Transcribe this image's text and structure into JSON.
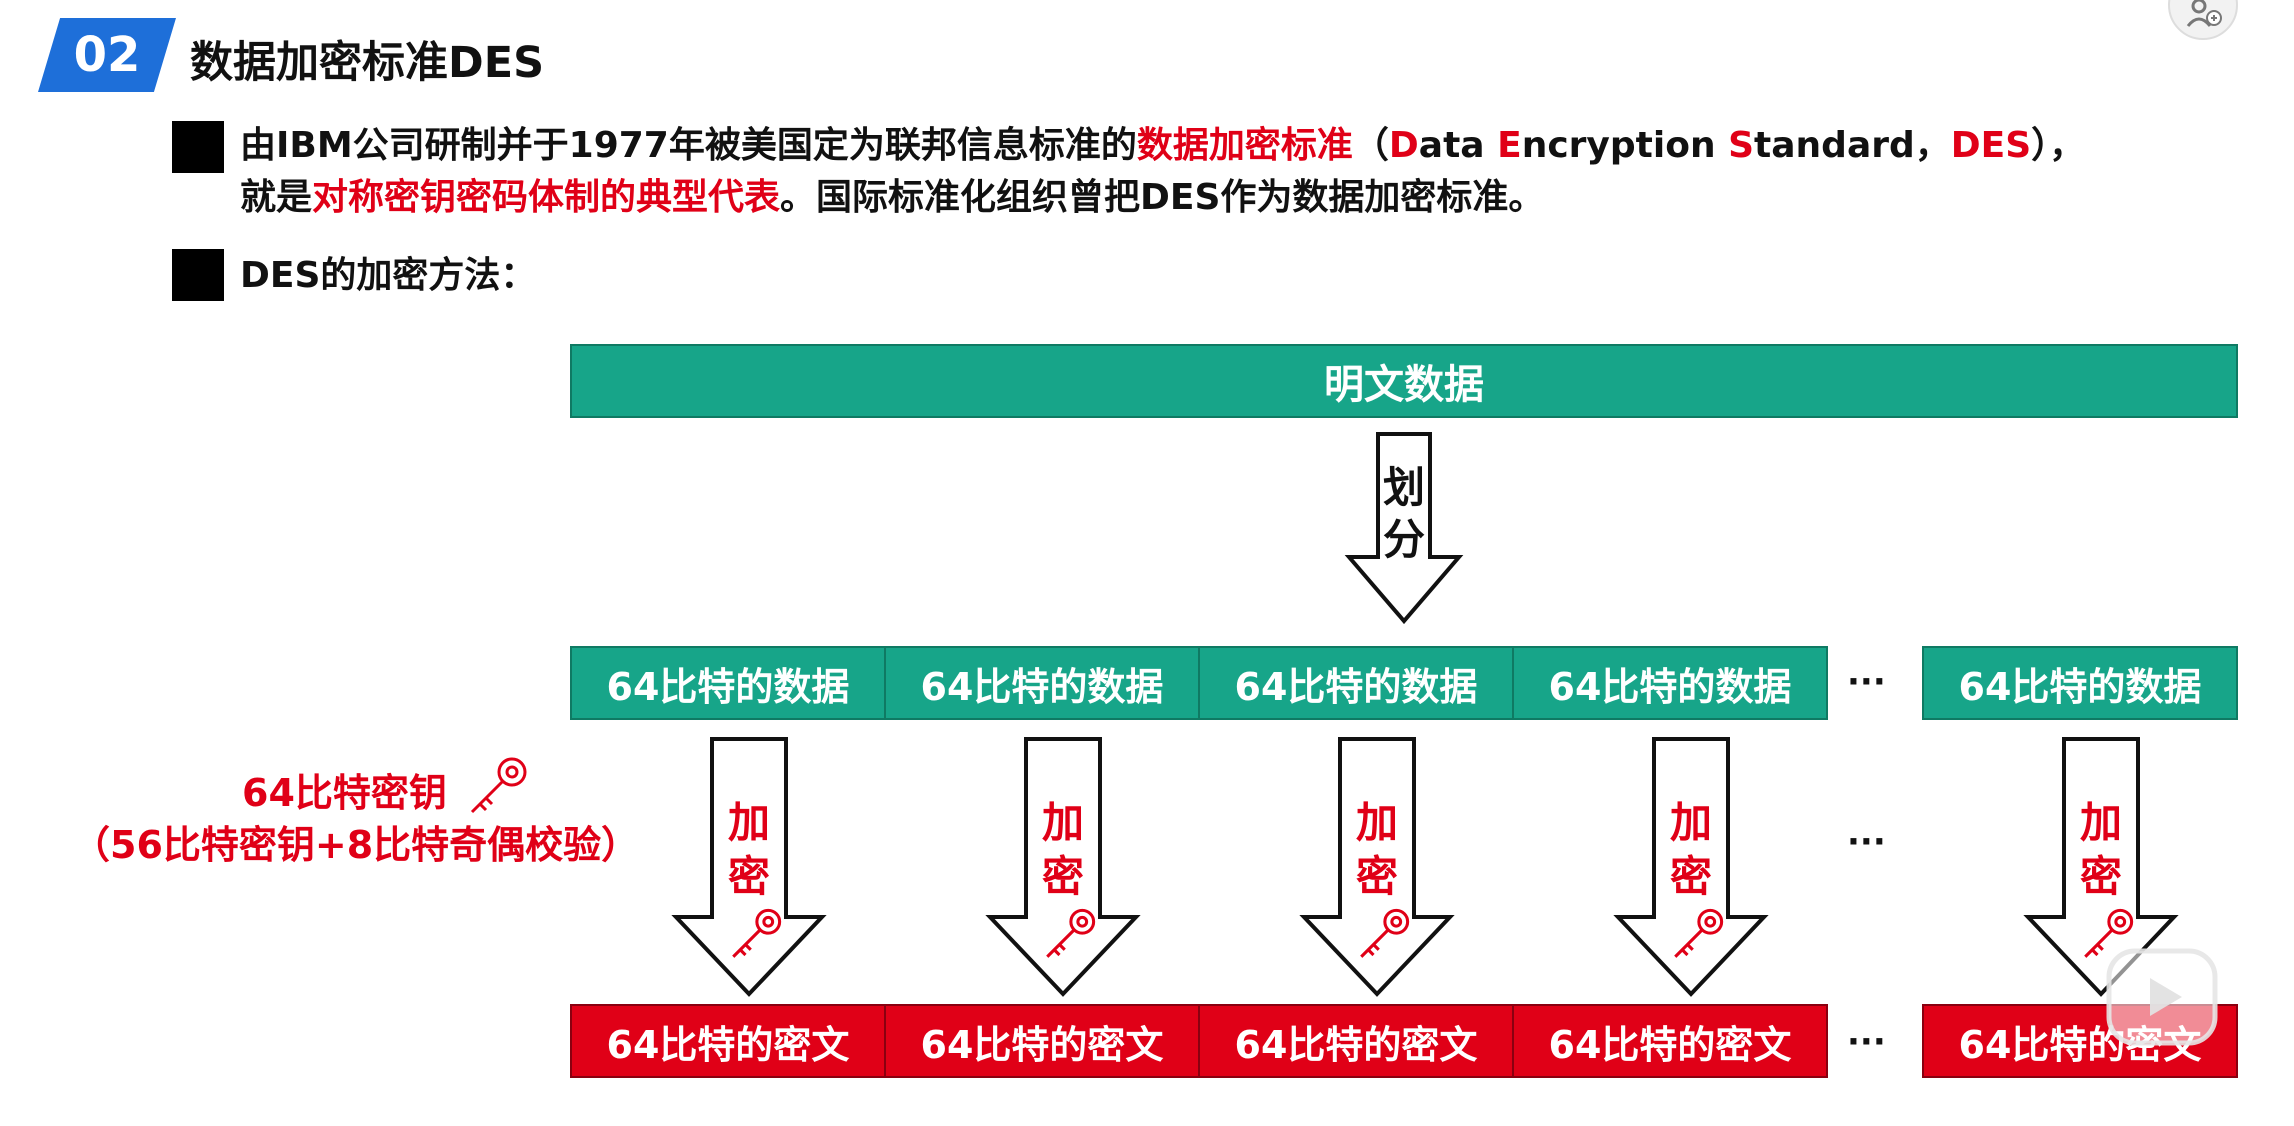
{
  "header": {
    "number": "02",
    "title": "数据加密标准DES"
  },
  "bullet1": {
    "line1_parts": [
      {
        "text": "由IBM公司研制并于1977年被美国定为联邦信息标准的",
        "red": false
      },
      {
        "text": "数据加密标准",
        "red": true
      },
      {
        "text": "（",
        "red": false
      },
      {
        "text": "D",
        "red": true
      },
      {
        "text": "ata ",
        "red": false
      },
      {
        "text": "E",
        "red": true
      },
      {
        "text": "ncryption ",
        "red": false
      },
      {
        "text": "S",
        "red": true
      },
      {
        "text": "tandard，",
        "red": false
      },
      {
        "text": "DES",
        "red": true
      },
      {
        "text": "），",
        "red": false
      }
    ],
    "line2_parts": [
      {
        "text": "就是",
        "red": false
      },
      {
        "text": "对称密钥密码体制的典型代表",
        "red": true
      },
      {
        "text": "。国际标准化组织曾把DES作为数据加密标准。",
        "red": false
      }
    ]
  },
  "bullet2": {
    "text": "DES的加密方法："
  },
  "diagram": {
    "plaintext_label": "明文数据",
    "split_label": "划分",
    "block_label": "64比特的数据",
    "encrypt_label": "加密",
    "cipher_label": "64比特的密文",
    "ellipsis": "···",
    "key_line1": "64比特密钥",
    "key_line2": "（56比特密钥+8比特奇偶校验）",
    "block_count": 5,
    "icons": [
      "key-icon",
      "play-button-icon",
      "user-add-icon"
    ],
    "colors": {
      "green": "#17a589",
      "red": "#e00017",
      "blue": "#1e6fd9"
    }
  }
}
